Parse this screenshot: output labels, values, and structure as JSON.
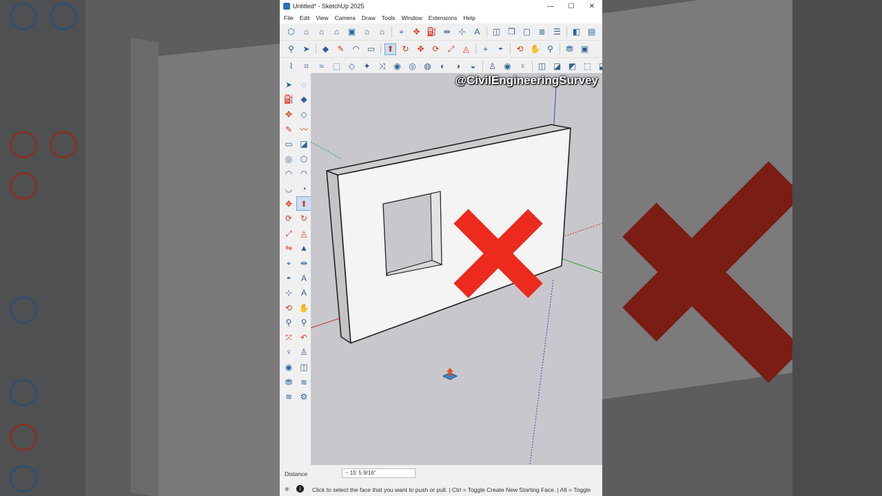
{
  "window": {
    "title": "Untitled* - SketchUp 2025",
    "minimize_glyph": "—",
    "maximize_glyph": "☐",
    "close_glyph": "✕"
  },
  "menu": [
    "File",
    "Edit",
    "View",
    "Camera",
    "Draw",
    "Tools",
    "Window",
    "Extensions",
    "Help"
  ],
  "toolbars": {
    "row1": [
      "box-icon",
      "house-front-icon",
      "house-icon",
      "house-side-icon",
      "house-top-icon",
      "house-right-icon",
      "house-back-icon",
      "sep",
      "tape-measure-icon",
      "move-icon",
      "paint-bucket-icon",
      "dimension-icon",
      "axes-icon",
      "text-icon",
      "sep",
      "section-plane-icon",
      "component-icon",
      "group-icon",
      "layers-icon",
      "outliner-icon",
      "sep",
      "styles-icon",
      "scenes-icon"
    ],
    "row2": [
      "zoom-icon",
      "select-icon",
      "sep",
      "eraser-icon",
      "pencil-icon",
      "arc-icon",
      "rectangle-icon",
      "sep",
      "push-pull-icon",
      "follow-me-icon",
      "move-icon",
      "rotate-icon",
      "scale-icon",
      "offset-icon",
      "sep",
      "tape-icon",
      "protractor-icon",
      "sep",
      "orbit-icon",
      "pan-icon",
      "zoom-window-icon",
      "sep",
      "warehouse-icon",
      "export-icon"
    ],
    "row3": [
      "sandbox-from-contours-icon",
      "sandbox-from-scratch-icon",
      "smoove-icon",
      "stamp-icon",
      "drape-icon",
      "add-detail-icon",
      "flip-edge-icon",
      "solid-tools-icon",
      "intersect-icon",
      "union-icon",
      "subtract-icon",
      "trim-icon",
      "split-icon",
      "sep",
      "walk-icon",
      "look-around-icon",
      "position-camera-icon",
      "sep",
      "section-display-icon",
      "section-cut-icon",
      "section-fill-icon",
      "xray-icon",
      "back-edges-icon",
      "wireframe-icon"
    ]
  },
  "left_tools": [
    [
      "select-icon",
      "lasso-icon"
    ],
    [
      "paint-bucket-icon",
      "eraser-icon"
    ],
    [
      "tag-icon",
      "eraser-soft-icon"
    ],
    [
      "pencil-icon",
      "freehand-icon"
    ],
    [
      "rectangle-icon",
      "rotated-rectangle-icon"
    ],
    [
      "circle-icon",
      "polygon-icon"
    ],
    [
      "arc-icon",
      "two-point-arc-icon"
    ],
    [
      "three-point-arc-icon",
      "pie-icon"
    ],
    [
      "move-icon",
      "push-pull-icon"
    ],
    [
      "rotate-icon",
      "follow-me-icon"
    ],
    [
      "scale-icon",
      "offset-icon"
    ],
    [
      "flip-icon",
      "solid-icon"
    ],
    [
      "tape-measure-icon",
      "dimension-icon"
    ],
    [
      "protractor-icon",
      "text-icon"
    ],
    [
      "axes-icon",
      "3d-text-icon"
    ],
    [
      "orbit-icon",
      "pan-icon"
    ],
    [
      "zoom-icon",
      "zoom-window-icon"
    ],
    [
      "zoom-extents-icon",
      "previous-view-icon"
    ],
    [
      "position-camera-icon",
      "walk-icon"
    ],
    [
      "look-around-icon",
      "section-plane-icon"
    ],
    [
      "warehouse-icon",
      "extension-warehouse-icon"
    ],
    [
      "layer-output-icon",
      "extension-manager-icon"
    ]
  ],
  "viewport": {
    "watermark": "@CivilEngineeringSurvey",
    "cursor": "push-pull-cursor-icon",
    "overlay": "red-x-mark-icon"
  },
  "vcb": {
    "label": "Distance",
    "value": "~ 15' 5 9/16\""
  },
  "status": {
    "message": "Click to select the face that you want to push or pull. | Ctrl = Toggle Create New Starting Face. | Alt = Toggle"
  },
  "colors": {
    "accent_blue": "#2e5f97",
    "accent_red": "#d23b1f",
    "x_mark_red": "#ec2a1e",
    "active_tool_bg": "#c9def5",
    "viewport_bg": "#c8c8cc"
  }
}
